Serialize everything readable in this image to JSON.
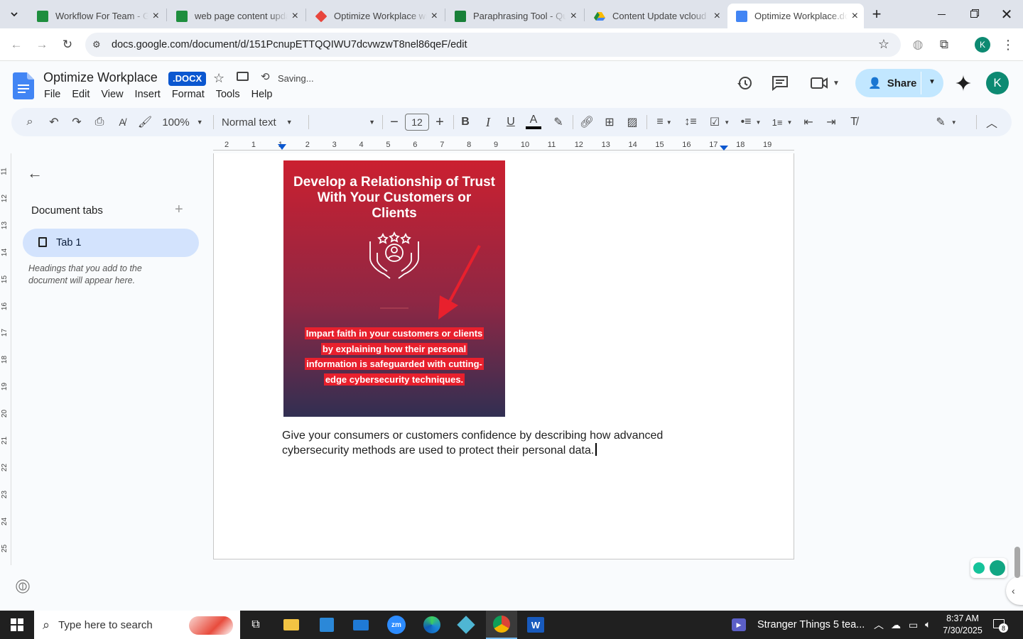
{
  "browser": {
    "tabs": [
      {
        "title": "Workflow For Team - Go",
        "color": "#1e8e3e"
      },
      {
        "title": "web page content upda",
        "color": "#1e8e3e"
      },
      {
        "title": "Optimize Workplace wit",
        "color": "#e8453c"
      },
      {
        "title": "Paraphrasing Tool - Qui",
        "color": "#188038"
      },
      {
        "title": "Content Update vcloud",
        "color": "#fbbc04"
      },
      {
        "title": "Optimize Workplace.do",
        "color": "#4285f4"
      }
    ],
    "url": "docs.google.com/document/d/151PcnupETTQQIWU7dcvwzwT8nel86qeF/edit",
    "profile_initial": "K"
  },
  "docs": {
    "title": "Optimize Workplace",
    "badge": ".DOCX",
    "status": "Saving...",
    "menu": [
      "File",
      "Edit",
      "View",
      "Insert",
      "Format",
      "Tools",
      "Help"
    ],
    "share_label": "Share",
    "avatar": "K",
    "zoom": "100%",
    "style": "Normal text",
    "font_size": "12"
  },
  "ruler": {
    "h": [
      "2",
      "1",
      "1",
      "2",
      "3",
      "4",
      "5",
      "6",
      "7",
      "8",
      "9",
      "10",
      "11",
      "12",
      "13",
      "14",
      "15",
      "16",
      "17",
      "18",
      "19"
    ],
    "v": [
      "11",
      "12",
      "13",
      "14",
      "15",
      "16",
      "17",
      "18",
      "19",
      "20",
      "21",
      "22",
      "23",
      "24",
      "25"
    ]
  },
  "sidebar": {
    "heading": "Document tabs",
    "tab_label": "Tab 1",
    "hint": "Headings that you add to the document will appear here."
  },
  "document": {
    "image_title": "Develop a Relationship of Trust With Your Customers or Clients",
    "image_caption": "Impart faith in your customers or clients by explaining how their personal information is safeguarded with cutting-edge cybersecurity techniques.",
    "paragraph": "Give your consumers or customers confidence by describing how advanced cybersecurity methods are used to protect their personal data."
  },
  "taskbar": {
    "search_placeholder": "Type here to search",
    "media": "Stranger Things 5 tea...",
    "time": "8:37 AM",
    "date": "7/30/2025",
    "notif_count": "8"
  },
  "colors": {
    "accent": "#0b57d0",
    "share_bg": "#c2e7ff",
    "tab_active_bg": "#d3e3fd",
    "avatar_bg": "#0d8a72"
  }
}
